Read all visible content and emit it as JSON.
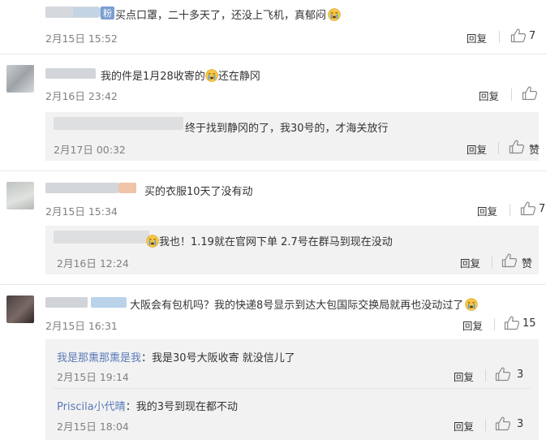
{
  "comments": [
    {
      "text": "买点口罩，二十多天了，还没上飞机，真郁闷",
      "badge": "粉",
      "time": "2月15日 15:52",
      "reply": "回复",
      "likes": "7",
      "replies": []
    },
    {
      "text_before": "我的件是1月28收寄的",
      "text_after": "还在静冈",
      "time": "2月16日 23:42",
      "reply": "回复",
      "likes": "",
      "replies": [
        {
          "text": "终于找到静冈的了，我30号的，才海关放行",
          "time": "2月17日 00:32",
          "reply": "回复",
          "likes": "赞"
        }
      ]
    },
    {
      "text": "买的衣服10天了没有动",
      "time": "2月15日 15:34",
      "reply": "回复",
      "likes": "7",
      "replies": [
        {
          "text": "我也！1.19就在官网下单 2.7号在群马到现在没动",
          "time": "2月16日 12:24",
          "reply": "回复",
          "likes": "赞"
        }
      ]
    },
    {
      "text": "大阪会有包机吗？我的快递8号显示到达大包国际交换局就再也没动过了",
      "time": "2月15日 16:31",
      "reply": "回复",
      "likes": "15",
      "replies": [
        {
          "user": "我是那熏那熏是我",
          "sep": "：",
          "text": "我是30号大阪收寄 就没信儿了",
          "time": "2月15日 19:14",
          "reply": "回复",
          "likes": "3"
        },
        {
          "user": "Priscila小代晴",
          "sep": "：",
          "text": "我的3号到现在都不动",
          "time": "2月15日 18:04",
          "reply": "回复",
          "likes": "3"
        }
      ]
    }
  ],
  "icons": {
    "thumb": "thumbs-up-icon",
    "emoji": "crying-emoji-icon"
  }
}
